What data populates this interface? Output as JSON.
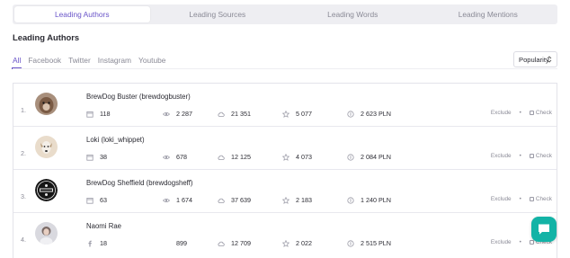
{
  "tabs": [
    {
      "label": "Leading Authors",
      "active": true
    },
    {
      "label": "Leading Sources",
      "active": false
    },
    {
      "label": "Leading Words",
      "active": false
    },
    {
      "label": "Leading Mentions",
      "active": false
    }
  ],
  "section_title": "Leading Authors",
  "filters": [
    {
      "label": "All",
      "active": true
    },
    {
      "label": "Facebook",
      "active": false
    },
    {
      "label": "Twitter",
      "active": false
    },
    {
      "label": "Instagram",
      "active": false
    },
    {
      "label": "Youtube",
      "active": false
    }
  ],
  "sort": {
    "label": "Popularity"
  },
  "authors": [
    {
      "rank": "1.",
      "name": "BrewDog Buster (brewdogbuster)",
      "source_icon": "calendar-icon",
      "mentions": "118",
      "views": "2 287",
      "reach": "21 351",
      "influence": "5 077",
      "value": "2 623 PLN",
      "exclude": "Exclude",
      "check": "Check"
    },
    {
      "rank": "2.",
      "name": "Loki (loki_whippet)",
      "source_icon": "calendar-icon",
      "mentions": "38",
      "views": "678",
      "reach": "12 125",
      "influence": "4 073",
      "value": "2 084 PLN",
      "exclude": "Exclude",
      "check": "Check"
    },
    {
      "rank": "3.",
      "name": "BrewDog Sheffield (brewdogsheff)",
      "source_icon": "calendar-icon",
      "mentions": "63",
      "views": "1 674",
      "reach": "37 639",
      "influence": "2 183",
      "value": "1 240 PLN",
      "exclude": "Exclude",
      "check": "Check"
    },
    {
      "rank": "4.",
      "name": "Naomi Rae",
      "source_icon": "facebook-icon",
      "mentions": "18",
      "views": "899",
      "reach": "12 709",
      "influence": "2 022",
      "value": "2 515 PLN",
      "exclude": "Exclude",
      "check": "Check"
    }
  ],
  "colors": {
    "accent": "#6a55c9",
    "chat": "#13b3a6"
  }
}
